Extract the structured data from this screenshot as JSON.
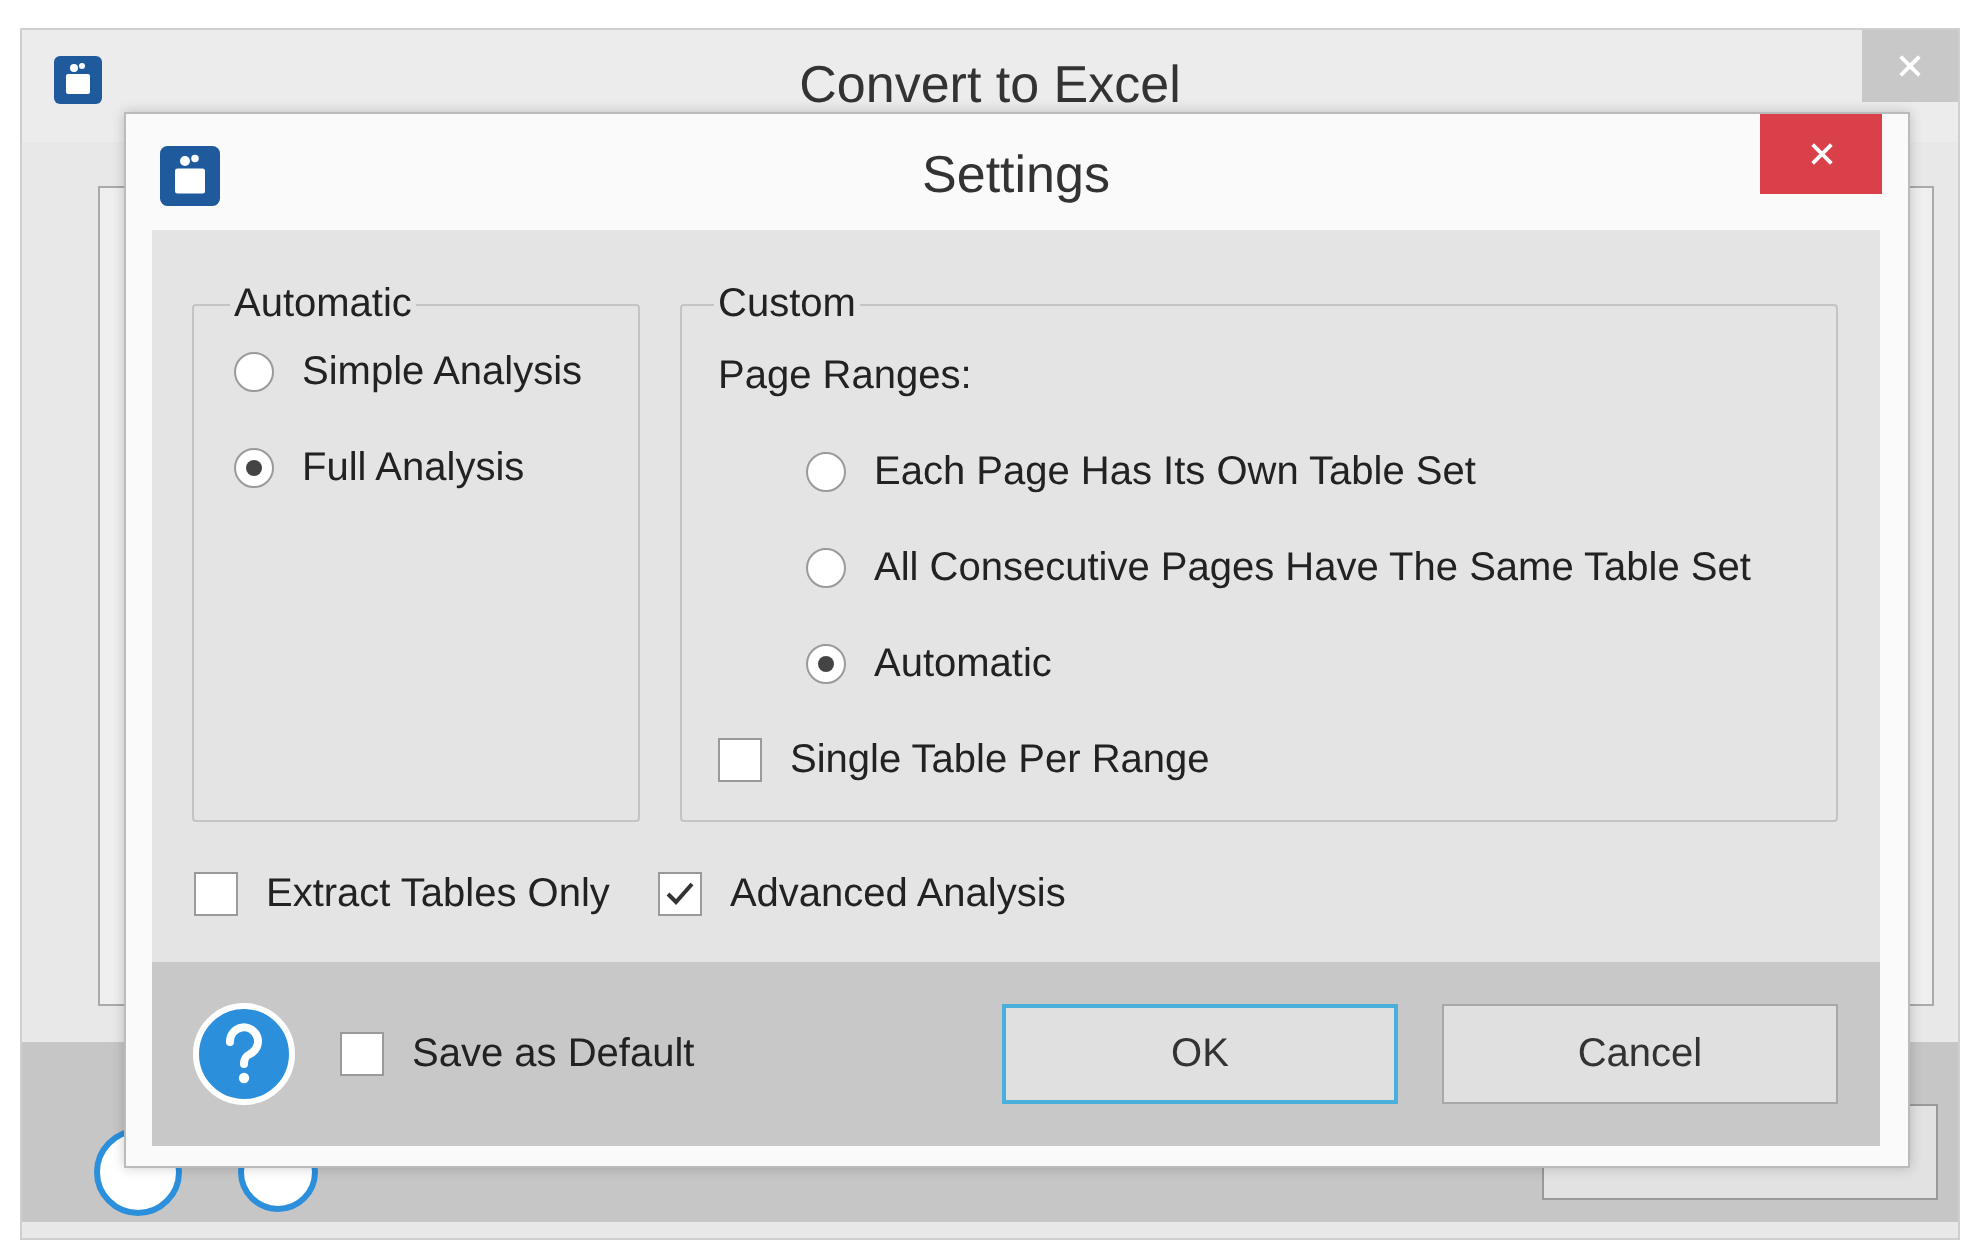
{
  "background_window": {
    "title": "Convert to Excel"
  },
  "dialog": {
    "title": "Settings"
  },
  "automatic_group": {
    "label": "Automatic",
    "options": [
      {
        "label": "Simple Analysis",
        "selected": false
      },
      {
        "label": "Full Analysis",
        "selected": true
      }
    ]
  },
  "custom_group": {
    "label": "Custom",
    "page_ranges_label": "Page Ranges:",
    "options": [
      {
        "label": "Each Page Has Its Own Table Set",
        "selected": false
      },
      {
        "label": "All Consecutive Pages Have The Same Table Set",
        "selected": false
      },
      {
        "label": "Automatic",
        "selected": true
      }
    ],
    "single_table_per_range": {
      "label": "Single Table Per Range",
      "checked": false
    }
  },
  "options": [
    {
      "label": "Extract Tables Only",
      "checked": false
    },
    {
      "label": "Advanced Analysis",
      "checked": true
    }
  ],
  "footer": {
    "save_as_default": {
      "label": "Save as Default",
      "checked": false
    },
    "buttons": [
      {
        "label": "OK",
        "kind": "default"
      },
      {
        "label": "Cancel",
        "kind": "normal"
      }
    ]
  }
}
